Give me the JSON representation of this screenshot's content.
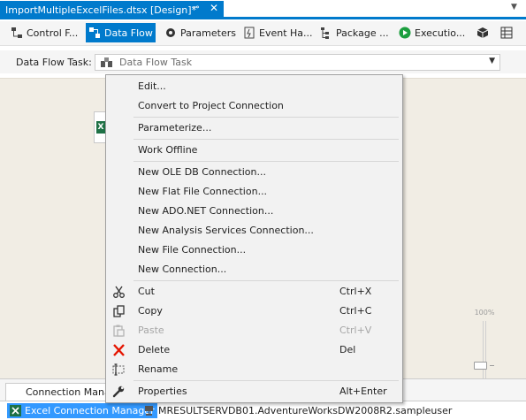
{
  "document_tab": {
    "title": "ImportMultipleExcelFiles.dtsx [Design]*",
    "pin_icon": "⊸",
    "close_icon": "✕"
  },
  "designer_tabs": [
    {
      "label": "Control F...",
      "icon": "control-flow-icon",
      "active": false
    },
    {
      "label": "Data Flow",
      "icon": "data-flow-icon",
      "active": true
    },
    {
      "label": "Parameters",
      "icon": "parameters-icon",
      "active": false
    },
    {
      "label": "Event Ha...",
      "icon": "event-handlers-icon",
      "active": false
    },
    {
      "label": "Package ...",
      "icon": "package-explorer-icon",
      "active": false
    },
    {
      "label": "Executio...",
      "icon": "execution-results-icon",
      "active": false
    }
  ],
  "data_flow_task": {
    "label": "Data Flow Task:",
    "value": "Data Flow Task"
  },
  "zoom": {
    "level": "100%"
  },
  "context_menu": [
    {
      "label": "Edit...",
      "shortcut": "",
      "icon": "",
      "disabled": false
    },
    {
      "label": "Convert to Project Connection",
      "shortcut": "",
      "icon": "",
      "disabled": false
    },
    {
      "label": "Parameterize...",
      "shortcut": "",
      "icon": "",
      "disabled": false
    },
    {
      "label": "Work Offline",
      "shortcut": "",
      "icon": "",
      "disabled": false
    },
    {
      "label": "New OLE DB Connection...",
      "shortcut": "",
      "icon": "",
      "disabled": false
    },
    {
      "label": "New Flat File Connection...",
      "shortcut": "",
      "icon": "",
      "disabled": false
    },
    {
      "label": "New ADO.NET Connection...",
      "shortcut": "",
      "icon": "",
      "disabled": false
    },
    {
      "label": "New Analysis Services Connection...",
      "shortcut": "",
      "icon": "",
      "disabled": false
    },
    {
      "label": "New File Connection...",
      "shortcut": "",
      "icon": "",
      "disabled": false
    },
    {
      "label": "New Connection...",
      "shortcut": "",
      "icon": "",
      "disabled": false
    },
    {
      "label": "Cut",
      "shortcut": "Ctrl+X",
      "icon": "scissors-icon",
      "disabled": false
    },
    {
      "label": "Copy",
      "shortcut": "Ctrl+C",
      "icon": "copy-icon",
      "disabled": false
    },
    {
      "label": "Paste",
      "shortcut": "Ctrl+V",
      "icon": "paste-icon",
      "disabled": true
    },
    {
      "label": "Delete",
      "shortcut": "Del",
      "icon": "delete-icon",
      "disabled": false
    },
    {
      "label": "Rename",
      "shortcut": "",
      "icon": "rename-icon",
      "disabled": false
    },
    {
      "label": "Properties",
      "shortcut": "Alt+Enter",
      "icon": "wrench-icon",
      "disabled": false
    }
  ],
  "connection_managers": {
    "tab_label": "Connection Managers",
    "items": [
      {
        "name": "Excel Connection Manager",
        "selected": true
      },
      {
        "name": "MRESULTSERVDB01.AdventureWorksDW2008R2.sampleuser",
        "selected": false
      }
    ]
  },
  "colors": {
    "accent": "#007acc",
    "selection": "#3399ff",
    "canvas": "#f1ede4",
    "menu_background": "#f2f2f2",
    "delete_red": "#e51400"
  }
}
